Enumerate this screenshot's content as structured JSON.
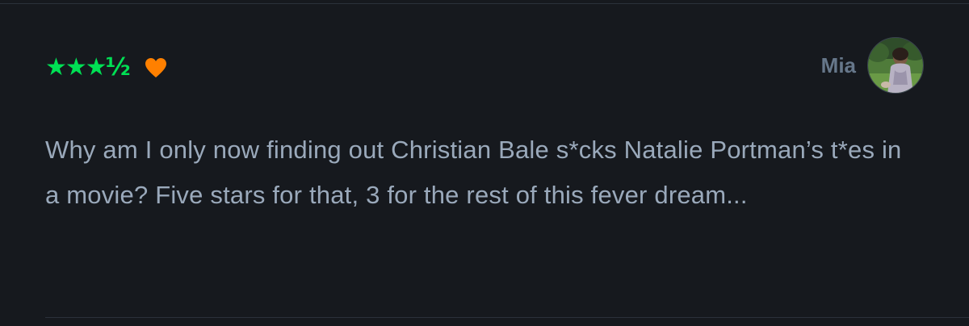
{
  "review": {
    "rating_stars": "★★★½",
    "liked": true,
    "heart_icon": "heart-icon",
    "author": "Mia",
    "avatar_icon": "avatar-photo",
    "text": "Why am I only now finding out Christian Bale s*cks Natalie Portman’s t*es in a movie? Five stars for that, 3 for the rest of this fever dream..."
  },
  "colors": {
    "background": "#16191e",
    "stars": "#00e054",
    "heart": "#ff8000",
    "author": "#66778a",
    "text": "#9aa9bb",
    "divider": "#2b313a"
  }
}
